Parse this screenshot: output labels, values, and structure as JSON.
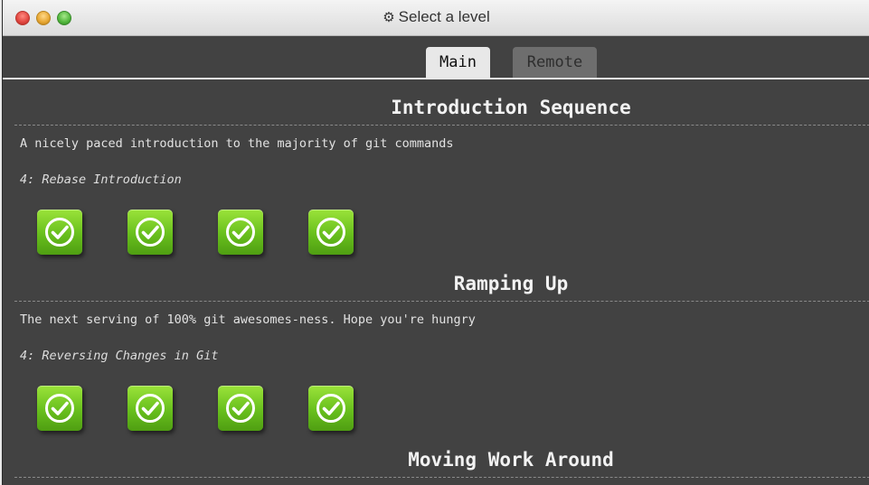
{
  "window": {
    "title": "Select a level",
    "title_icon": "gear-icon",
    "traffic_lights": [
      "close",
      "minimize",
      "maximize"
    ]
  },
  "tabs": [
    {
      "label": "Main",
      "selected": true
    },
    {
      "label": "Remote",
      "selected": false
    }
  ],
  "sequences": [
    {
      "title": "Introduction Sequence",
      "description": "A nicely paced introduction to the majority of git commands",
      "current_level": "4: Rebase Introduction",
      "levels": [
        {
          "icon": "checkmark-icon",
          "completed": true
        },
        {
          "icon": "checkmark-icon",
          "completed": true
        },
        {
          "icon": "checkmark-icon",
          "completed": true
        },
        {
          "icon": "checkmark-icon",
          "completed": true
        }
      ]
    },
    {
      "title": "Ramping Up",
      "description": "The next serving of 100% git awesomes-ness. Hope you're hungry",
      "current_level": "4: Reversing Changes in Git",
      "levels": [
        {
          "icon": "checkmark-icon",
          "completed": true
        },
        {
          "icon": "checkmark-icon",
          "completed": true
        },
        {
          "icon": "checkmark-icon",
          "completed": true
        },
        {
          "icon": "checkmark-icon",
          "completed": true
        }
      ]
    },
    {
      "title": "Moving Work Around"
    }
  ],
  "colors": {
    "panel_bg": "#424242",
    "level_complete": "#6ac41f",
    "tab_active_bg": "#e8e8e8",
    "tab_inactive_bg": "#6e6e6e"
  }
}
